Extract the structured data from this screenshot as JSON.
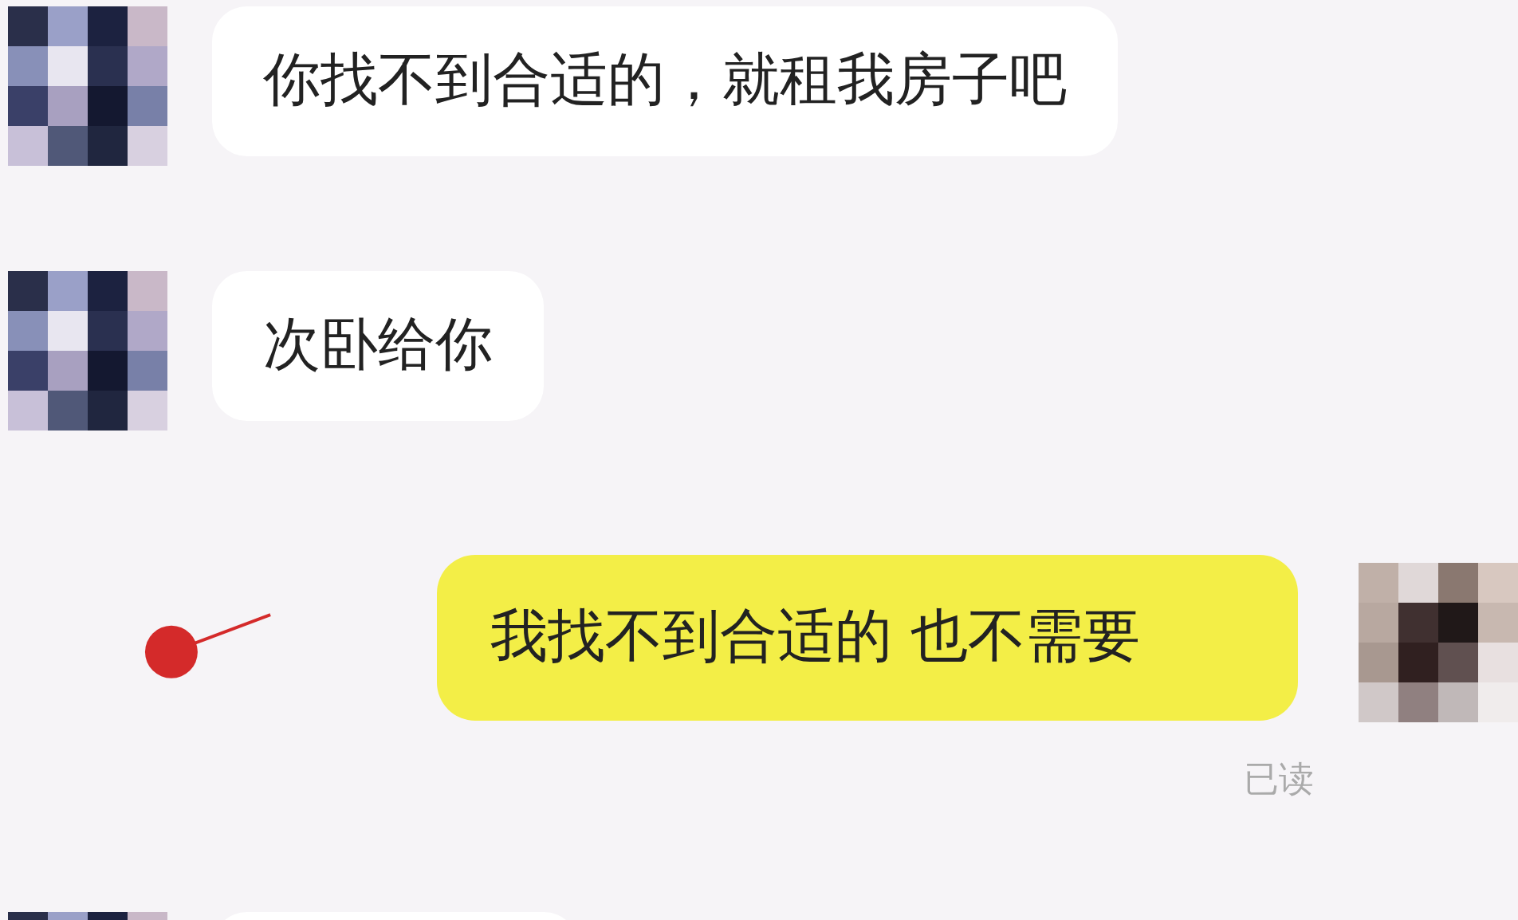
{
  "messages": [
    {
      "kind": "incoming",
      "text": "你找不到合适的，就租我房子吧"
    },
    {
      "kind": "incoming",
      "text": "次卧给你"
    },
    {
      "kind": "outgoing",
      "text": "我找不到合适的 也不需要",
      "status": "已读"
    },
    {
      "kind": "incoming"
    }
  ]
}
